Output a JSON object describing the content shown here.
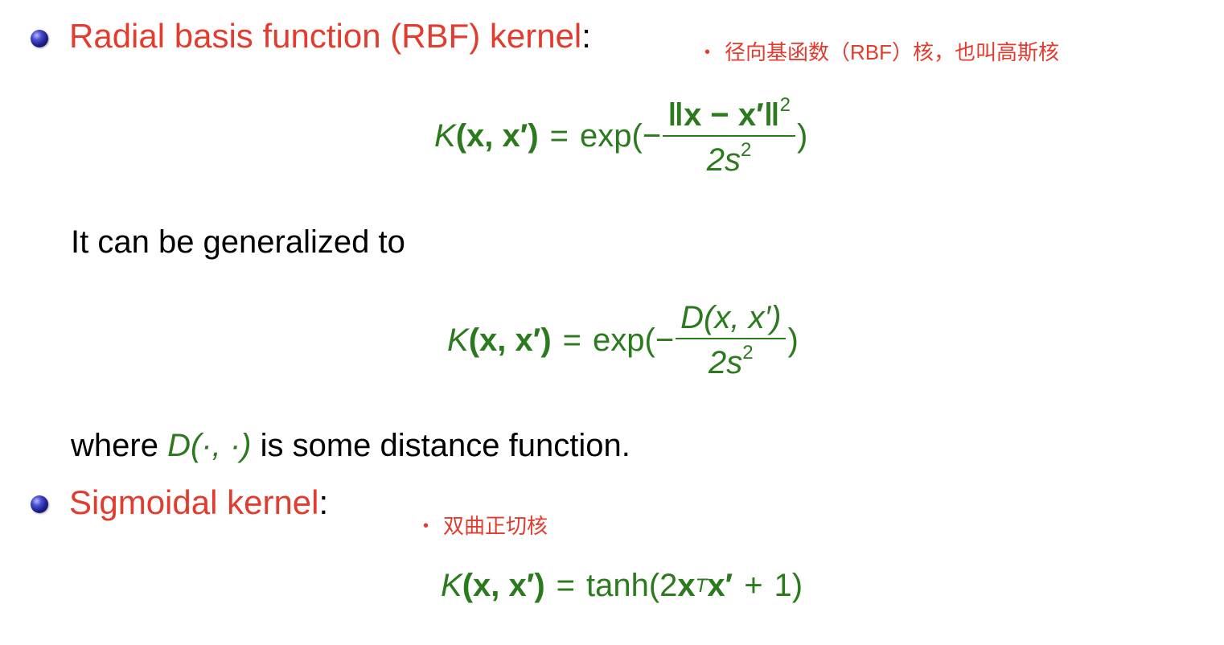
{
  "rbf": {
    "heading": "Radial basis function (RBF) kernel",
    "colon": ":",
    "note_bullet": "•",
    "note": "径向基函数（RBF）核，也叫高斯核",
    "formula": {
      "K": "K",
      "args": "(x, x′)",
      "eq": "=",
      "exp_open": "exp(−",
      "numerator": "‖x − x′‖",
      "num_sup": "2",
      "denominator": "2s",
      "den_sup": "2",
      "close": ")"
    }
  },
  "generalized": {
    "text": "It can be generalized to",
    "formula": {
      "K": "K",
      "args": "(x, x′)",
      "eq": "=",
      "exp_open": "exp(−",
      "numerator": "D(x, x′)",
      "denominator": "2s",
      "den_sup": "2",
      "close": ")"
    }
  },
  "where": {
    "prefix": "where ",
    "symbol": "D(·, ·)",
    "suffix": " is some distance function."
  },
  "sigmoid": {
    "heading": "Sigmoidal kernel",
    "colon": ":",
    "note_bullet": "•",
    "note": "双曲正切核",
    "formula": {
      "K": "K",
      "args": "(x, x′)",
      "eq": "=",
      "tanh_open": "tanh(2",
      "x": "x",
      "sup": "T",
      "xprime": "x′",
      "plus": "+",
      "one": "1)"
    }
  }
}
